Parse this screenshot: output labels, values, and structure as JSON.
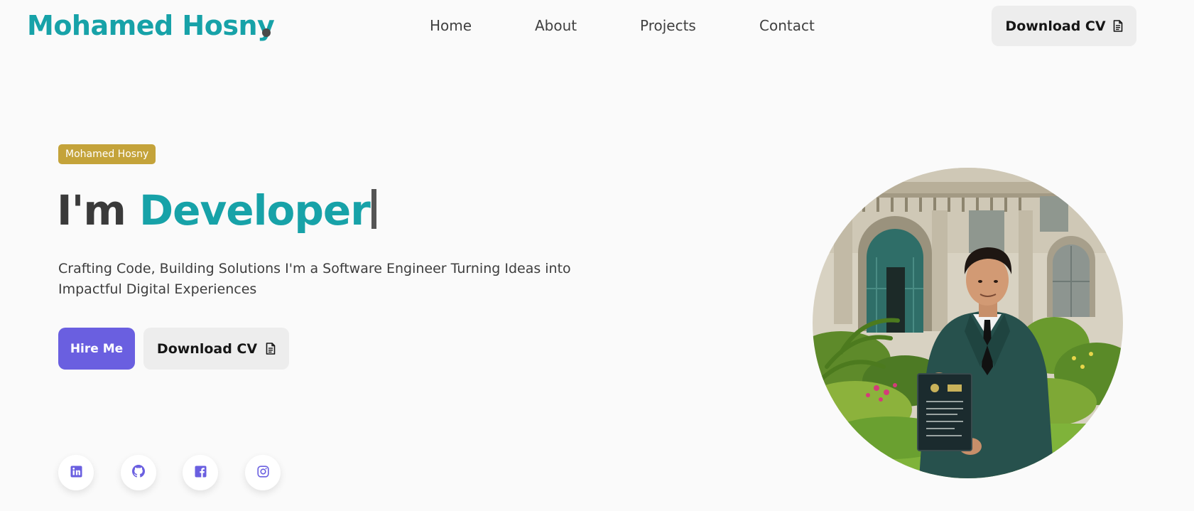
{
  "header": {
    "logo_text": "Mohamed Hosny",
    "nav": [
      {
        "label": "Home"
      },
      {
        "label": "About"
      },
      {
        "label": "Projects"
      },
      {
        "label": "Contact"
      }
    ],
    "cv_button_label": "Download CV"
  },
  "hero": {
    "badge": "Mohamed Hosny",
    "title_prefix": "I'm",
    "title_accent": "Developer",
    "description": "Crafting Code, Building Solutions I'm a Software Engineer Turning Ideas into Impactful Digital Experiences",
    "hire_label": "Hire Me",
    "cv_label": "Download CV"
  },
  "socials": [
    {
      "icon": "linkedin-icon"
    },
    {
      "icon": "github-icon"
    },
    {
      "icon": "facebook-icon"
    },
    {
      "icon": "instagram-icon"
    }
  ],
  "colors": {
    "accent": "#17a2a8",
    "primary_button": "#6a5fe0",
    "badge": "#c4a33a",
    "secondary_button": "#ededed",
    "background": "#fafafa"
  }
}
